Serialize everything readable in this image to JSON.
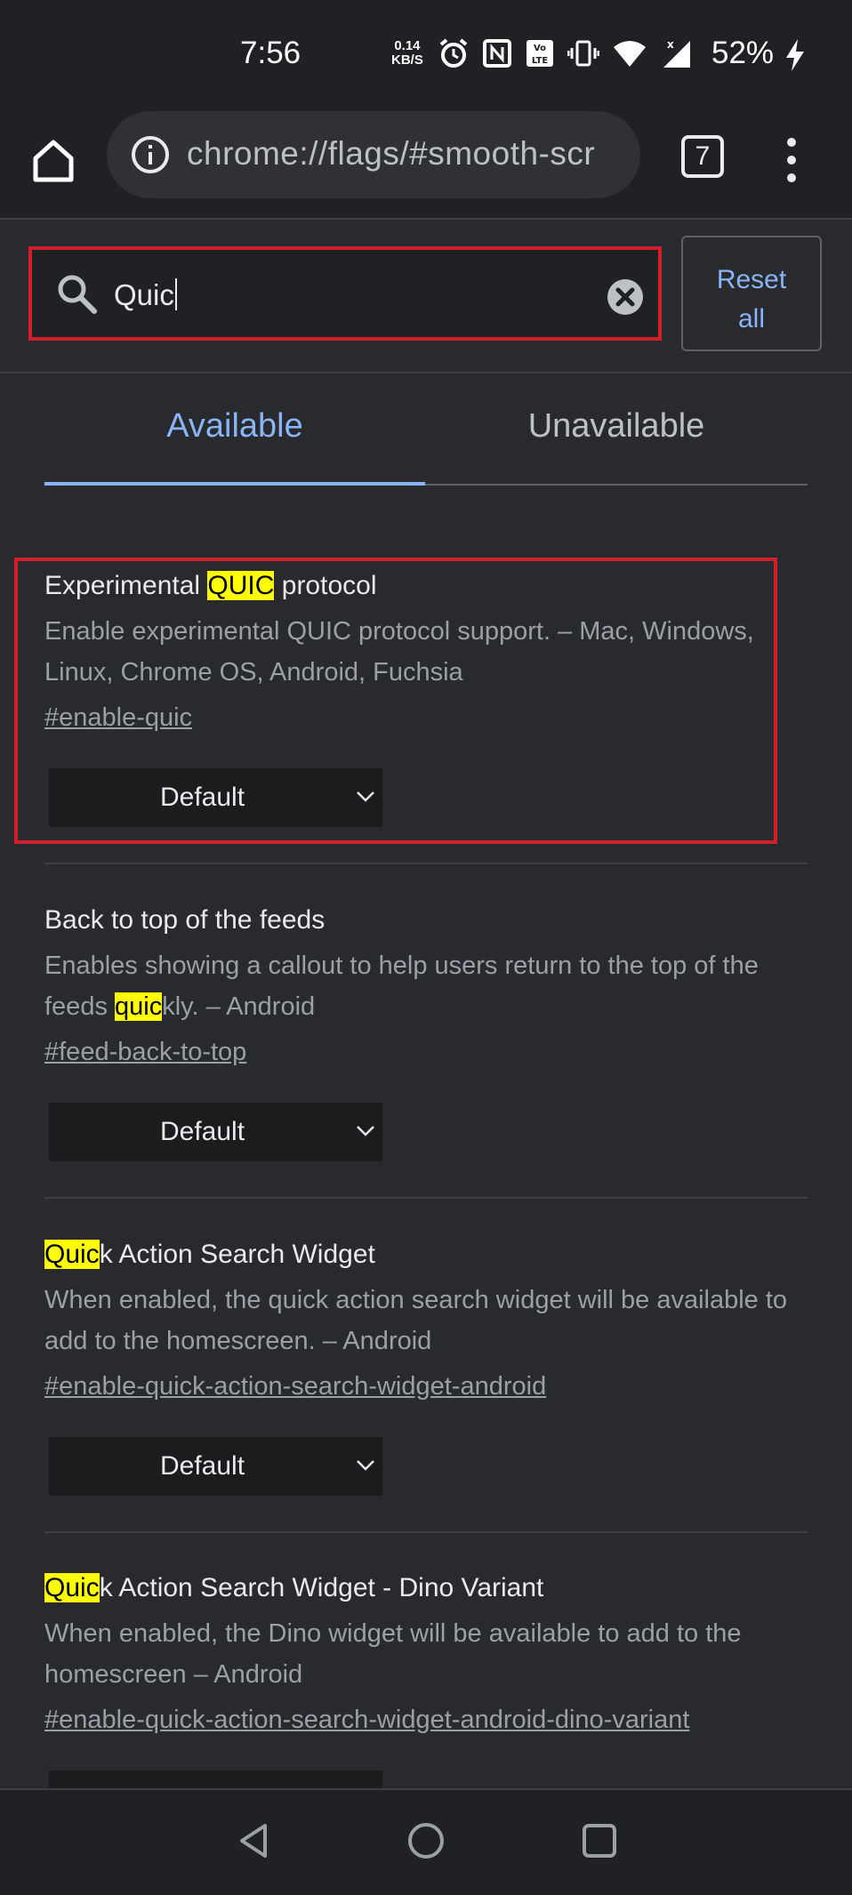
{
  "status_bar": {
    "time": "7:56",
    "net_speed_value": "0.14",
    "net_speed_unit": "KB/S",
    "battery": "52%"
  },
  "browser": {
    "url": "chrome://flags/#smooth-scr",
    "tab_count": "7"
  },
  "search": {
    "query": "Quic",
    "reset_label": "Reset all"
  },
  "tabs": [
    {
      "label": "Available",
      "selected": true
    },
    {
      "label": "Unavailable",
      "selected": false
    }
  ],
  "flags": [
    {
      "title_before": "Experimental ",
      "title_highlight": "QUIC",
      "title_after": " protocol",
      "desc_before": "Enable experimental QUIC protocol support. – Mac, Windows, Linux, Chrome OS, Android, Fuchsia",
      "desc_highlight": "",
      "desc_after": "",
      "link": "#enable-quic",
      "value": "Default"
    },
    {
      "title_before": "Back to top of the feeds",
      "title_highlight": "",
      "title_after": "",
      "desc_before": "Enables showing a callout to help users return to the top of the feeds ",
      "desc_highlight": "quic",
      "desc_after": "kly. – Android",
      "link": "#feed-back-to-top",
      "value": "Default"
    },
    {
      "title_before": "",
      "title_highlight": "Quic",
      "title_after": "k Action Search Widget",
      "desc_before": "When enabled, the quick action search widget will be available to add to the homescreen. – Android",
      "desc_highlight": "",
      "desc_after": "",
      "link": "#enable-quick-action-search-widget-android",
      "value": "Default"
    },
    {
      "title_before": "",
      "title_highlight": "Quic",
      "title_after": "k Action Search Widget - Dino Variant",
      "desc_before": "When enabled, the Dino widget will be available to add to the homescreen – Android",
      "desc_highlight": "",
      "desc_after": "",
      "link": "#enable-quick-action-search-widget-android-dino-variant",
      "value": ""
    }
  ],
  "colors": {
    "background": "#292a2d",
    "accent": "#8ab4f8",
    "search_highlight": "#ffff00",
    "annotation_red": "#d21f2a"
  }
}
